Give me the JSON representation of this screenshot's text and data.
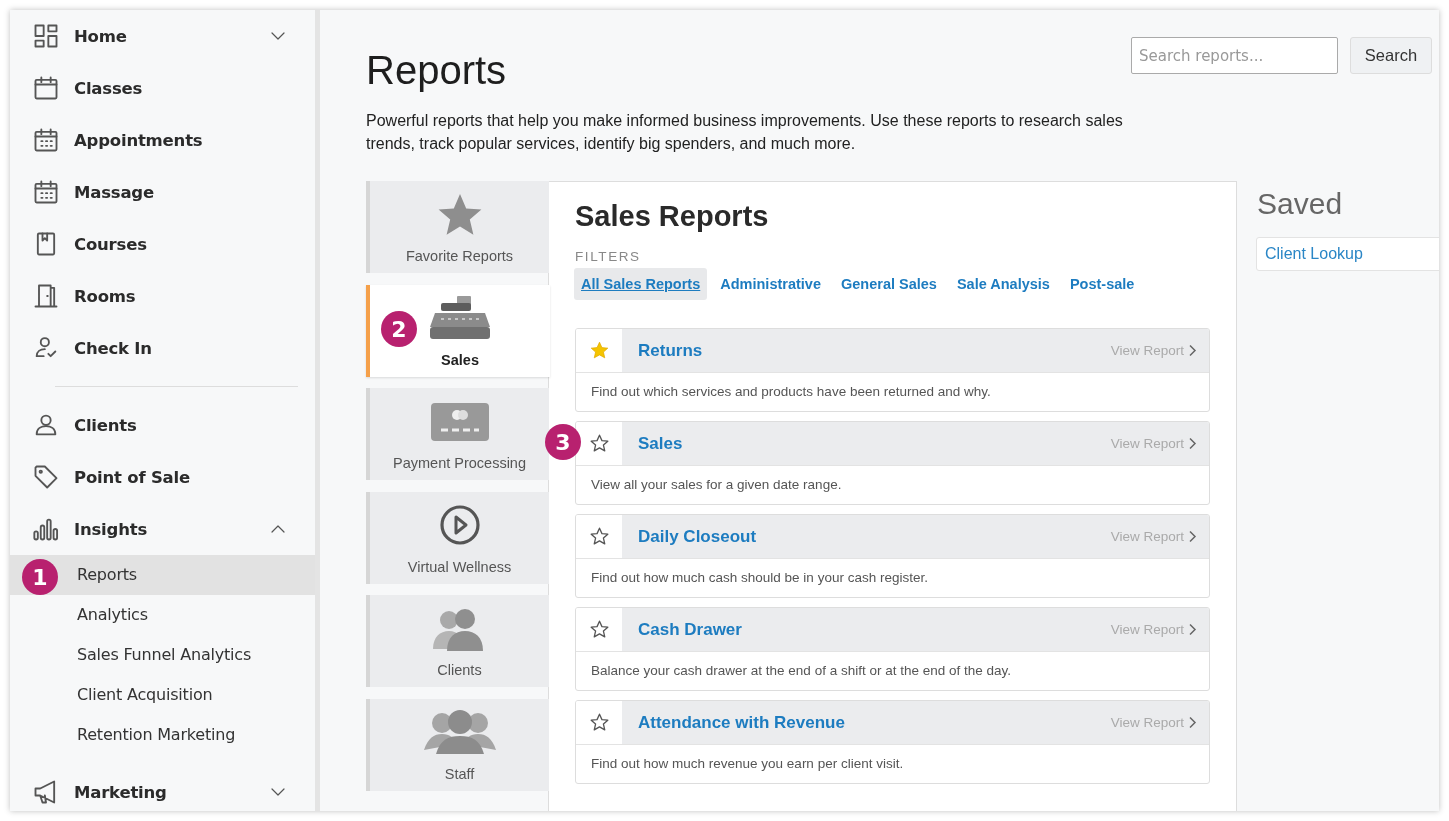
{
  "sidebar": {
    "sections": [
      [
        {
          "label": "Home",
          "expanded": false
        },
        {
          "label": "Classes"
        },
        {
          "label": "Appointments"
        },
        {
          "label": "Massage"
        },
        {
          "label": "Courses"
        },
        {
          "label": "Rooms"
        },
        {
          "label": "Check In"
        }
      ],
      [
        {
          "label": "Clients"
        },
        {
          "label": "Point of Sale"
        },
        {
          "label": "Insights",
          "expanded": true,
          "children": [
            {
              "label": "Reports",
              "selected": true
            },
            {
              "label": "Analytics",
              "selected": false
            },
            {
              "label": "Sales Funnel Analytics",
              "selected": false
            },
            {
              "label": "Client Acquisition",
              "selected": false
            },
            {
              "label": "Retention Marketing",
              "selected": false
            }
          ]
        },
        {
          "label": "Marketing",
          "expanded": false
        }
      ]
    ]
  },
  "page": {
    "title": "Reports",
    "description": "Powerful reports that help you make informed business improvements. Use these reports to research sales trends, track popular services, identify big spenders, and much more.",
    "search": {
      "placeholder": "Search reports...",
      "button": "Search"
    }
  },
  "categories": [
    {
      "label": "Favorite Reports",
      "selected": false
    },
    {
      "label": "Sales",
      "selected": true
    },
    {
      "label": "Payment Processing",
      "selected": false
    },
    {
      "label": "Virtual Wellness",
      "selected": false
    },
    {
      "label": "Clients",
      "selected": false
    },
    {
      "label": "Staff",
      "selected": false
    }
  ],
  "panel": {
    "title": "Sales Reports",
    "filters_label": "FILTERS",
    "filters": [
      {
        "label": "All Sales Reports",
        "selected": true
      },
      {
        "label": "Administrative",
        "selected": false
      },
      {
        "label": "General Sales",
        "selected": false
      },
      {
        "label": "Sale Analysis",
        "selected": false
      },
      {
        "label": "Post-sale",
        "selected": false
      }
    ],
    "reports": [
      {
        "title": "Returns",
        "favorite": true,
        "link": "View Report",
        "description": "Find out which services and products have been returned and why."
      },
      {
        "title": "Sales",
        "favorite": false,
        "link": "View Report",
        "description": "View all your sales for a given date range."
      },
      {
        "title": "Daily Closeout",
        "favorite": false,
        "link": "View Report",
        "description": "Find out how much cash should be in your cash register."
      },
      {
        "title": "Cash Drawer",
        "favorite": false,
        "link": "View Report",
        "description": "Balance your cash drawer at the end of a shift or at the end of the day."
      },
      {
        "title": "Attendance with Revenue",
        "favorite": false,
        "link": "View Report",
        "description": "Find out how much revenue you earn per client visit."
      }
    ]
  },
  "saved": {
    "title": "Saved",
    "items": [
      "Client Lookup"
    ]
  },
  "annotations": [
    {
      "text": "1"
    },
    {
      "text": "2"
    },
    {
      "text": "3"
    }
  ]
}
